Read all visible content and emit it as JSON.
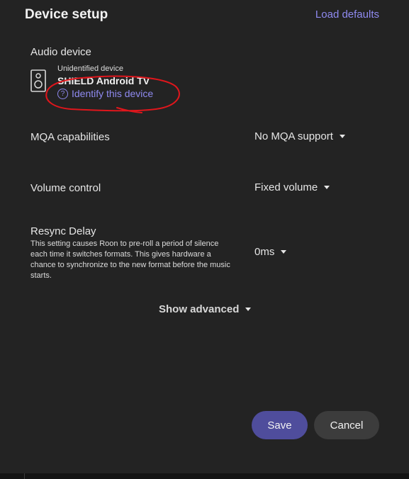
{
  "header": {
    "title": "Device setup",
    "load_defaults": "Load defaults"
  },
  "audio_device": {
    "label": "Audio device",
    "status": "Unidentified device",
    "name": "SHIELD Android TV",
    "identify_link": "Identify this device",
    "icon": "speaker-icon"
  },
  "settings": {
    "mqa": {
      "label": "MQA capabilities",
      "value": "No MQA support"
    },
    "volume": {
      "label": "Volume control",
      "value": "Fixed volume"
    },
    "resync": {
      "label": "Resync Delay",
      "description": "This setting causes Roon to pre-roll a period of silence each time it switches formats. This gives hardware a chance to synchronize to the new format before the music starts.",
      "value": "0ms"
    }
  },
  "show_advanced": "Show advanced",
  "buttons": {
    "save": "Save",
    "cancel": "Cancel"
  },
  "colors": {
    "accent": "#8f8af0",
    "save_bg": "#4f4d9c",
    "cancel_bg": "#3c3c3c",
    "background": "#232323",
    "annotation": "#e0161c"
  }
}
